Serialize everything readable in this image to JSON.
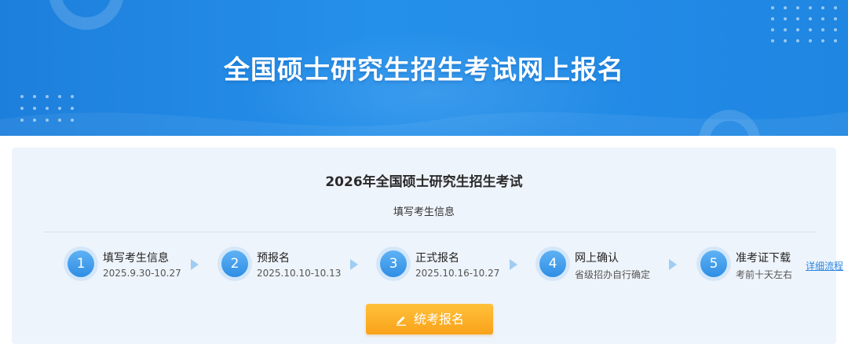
{
  "banner": {
    "title": "全国硕士研究生招生考试网上报名"
  },
  "panel": {
    "exam_title": "2026年全国硕士研究生招生考试",
    "current_stage": "填写考生信息",
    "steps": [
      {
        "number": "1",
        "name": "填写考生信息",
        "date": "2025.9.30-10.27"
      },
      {
        "number": "2",
        "name": "预报名",
        "date": "2025.10.10-10.13"
      },
      {
        "number": "3",
        "name": "正式报名",
        "date": "2025.10.16-10.27"
      },
      {
        "number": "4",
        "name": "网上确认",
        "date": "省级招办自行确定"
      },
      {
        "number": "5",
        "name": "准考证下载",
        "date": "考前十天左右"
      }
    ],
    "detail_link": "详细流程",
    "apply_button": "统考报名",
    "apply_icon": "pencil-icon"
  },
  "colors": {
    "banner_blue": "#1d7fdc",
    "panel_bg": "#eef4fb",
    "step_blue": "#2f8ee4",
    "button_orange": "#f9a21a",
    "link_blue": "#2b86e0"
  }
}
